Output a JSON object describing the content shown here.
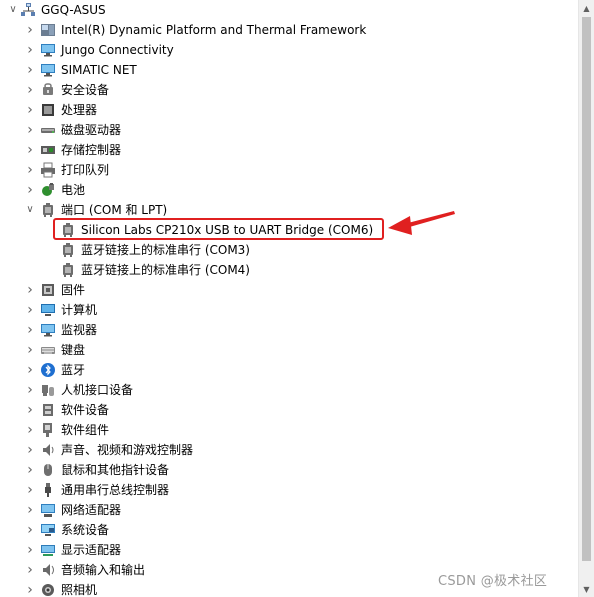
{
  "root": {
    "label": "GGQ-ASUS",
    "icon": "computer-network-icon",
    "expanded": true
  },
  "categories": [
    {
      "label": "Intel(R) Dynamic Platform and Thermal Framework",
      "icon": "intel-platform-icon",
      "expanded": false
    },
    {
      "label": "Jungo Connectivity",
      "icon": "monitor-icon",
      "expanded": false
    },
    {
      "label": "SIMATIC NET",
      "icon": "monitor-icon",
      "expanded": false
    },
    {
      "label": "安全设备",
      "icon": "security-key-icon",
      "expanded": false
    },
    {
      "label": "处理器",
      "icon": "processor-icon",
      "expanded": false
    },
    {
      "label": "磁盘驱动器",
      "icon": "disk-drive-icon",
      "expanded": false
    },
    {
      "label": "存储控制器",
      "icon": "storage-controller-icon",
      "expanded": false
    },
    {
      "label": "打印队列",
      "icon": "printer-icon",
      "expanded": false
    },
    {
      "label": "电池",
      "icon": "battery-icon",
      "expanded": false
    },
    {
      "label": "端口 (COM 和 LPT)",
      "icon": "port-icon",
      "expanded": true,
      "children": [
        {
          "label": "Silicon Labs CP210x USB to UART Bridge (COM6)",
          "icon": "port-icon",
          "highlighted": true
        },
        {
          "label": "蓝牙链接上的标准串行 (COM3)",
          "icon": "port-icon"
        },
        {
          "label": "蓝牙链接上的标准串行 (COM4)",
          "icon": "port-icon"
        }
      ]
    },
    {
      "label": "固件",
      "icon": "firmware-icon",
      "expanded": false
    },
    {
      "label": "计算机",
      "icon": "computer-icon",
      "expanded": false
    },
    {
      "label": "监视器",
      "icon": "monitor-icon",
      "expanded": false
    },
    {
      "label": "键盘",
      "icon": "keyboard-icon",
      "expanded": false
    },
    {
      "label": "蓝牙",
      "icon": "bluetooth-icon",
      "expanded": false
    },
    {
      "label": "人机接口设备",
      "icon": "hid-icon",
      "expanded": false
    },
    {
      "label": "软件设备",
      "icon": "software-device-icon",
      "expanded": false
    },
    {
      "label": "软件组件",
      "icon": "software-component-icon",
      "expanded": false
    },
    {
      "label": "声音、视频和游戏控制器",
      "icon": "speaker-icon",
      "expanded": false
    },
    {
      "label": "鼠标和其他指针设备",
      "icon": "mouse-icon",
      "expanded": false
    },
    {
      "label": "通用串行总线控制器",
      "icon": "usb-icon",
      "expanded": false
    },
    {
      "label": "网络适配器",
      "icon": "network-adapter-icon",
      "expanded": false
    },
    {
      "label": "系统设备",
      "icon": "system-device-icon",
      "expanded": false
    },
    {
      "label": "显示适配器",
      "icon": "display-adapter-icon",
      "expanded": false
    },
    {
      "label": "音频输入和输出",
      "icon": "audio-io-icon",
      "expanded": false
    },
    {
      "label": "照相机",
      "icon": "camera-icon",
      "expanded": false
    }
  ],
  "watermark": "CSDN @极术社区",
  "colors": {
    "highlight": "#e02020",
    "arrow": "#e02020",
    "watermark": "#9a9a9a"
  }
}
